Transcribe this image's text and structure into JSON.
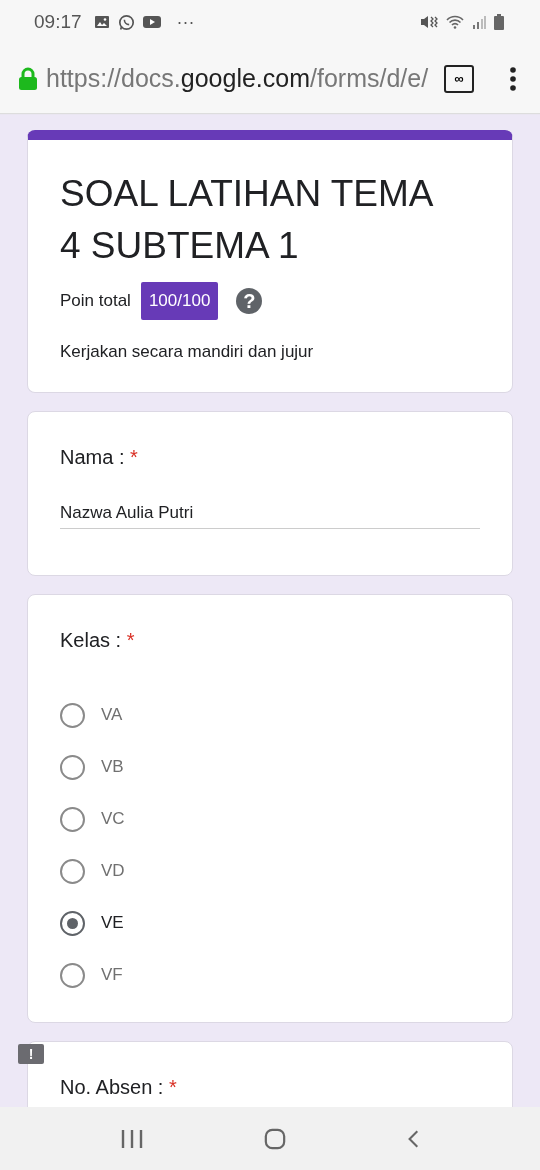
{
  "status_bar": {
    "time": "09:17",
    "overflow": "···"
  },
  "address_bar": {
    "url_scheme": "https://docs.",
    "url_host": "google.com",
    "url_path": "/forms/d/e/",
    "tab_count": "∞",
    "secure": true
  },
  "form_header": {
    "title": "SOAL LATIHAN TEMA 4 SUBTEMA 1",
    "points_label": "Poin total",
    "points": "100/100",
    "help": "?",
    "description": "Kerjakan secara mandiri dan jujur"
  },
  "questions": [
    {
      "kind": "text",
      "label": "Nama :",
      "required_mark": "*",
      "value": "Nazwa Aulia Putri",
      "error": false
    },
    {
      "kind": "radio",
      "label": "Kelas :",
      "required_mark": "*",
      "error": false,
      "options": [
        {
          "label": "VA",
          "selected": false
        },
        {
          "label": "VB",
          "selected": false
        },
        {
          "label": "VC",
          "selected": false
        },
        {
          "label": "VD",
          "selected": false
        },
        {
          "label": "VE",
          "selected": true
        },
        {
          "label": "VF",
          "selected": false
        }
      ]
    },
    {
      "kind": "text",
      "label": "No. Absen :",
      "required_mark": "*",
      "error": true,
      "error_mark": "!"
    }
  ]
}
